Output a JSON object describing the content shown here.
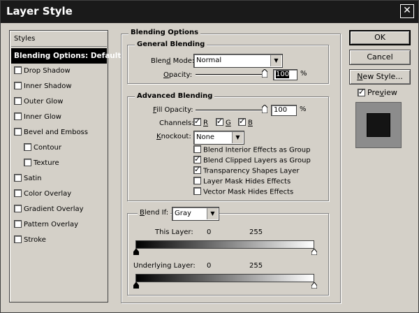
{
  "window": {
    "title": "Layer Style"
  },
  "styles_list": {
    "header": "Styles",
    "selected": "Blending Options: Default",
    "items": [
      {
        "label": "Drop Shadow",
        "checked": false,
        "indent": false
      },
      {
        "label": "Inner Shadow",
        "checked": false,
        "indent": false
      },
      {
        "label": "Outer Glow",
        "checked": false,
        "indent": false
      },
      {
        "label": "Inner Glow",
        "checked": false,
        "indent": false
      },
      {
        "label": "Bevel and Emboss",
        "checked": false,
        "indent": false
      },
      {
        "label": "Contour",
        "checked": false,
        "indent": true
      },
      {
        "label": "Texture",
        "checked": false,
        "indent": true
      },
      {
        "label": "Satin",
        "checked": false,
        "indent": false
      },
      {
        "label": "Color Overlay",
        "checked": false,
        "indent": false
      },
      {
        "label": "Gradient Overlay",
        "checked": false,
        "indent": false
      },
      {
        "label": "Pattern Overlay",
        "checked": false,
        "indent": false
      },
      {
        "label": "Stroke",
        "checked": false,
        "indent": false
      }
    ]
  },
  "blending": {
    "title": "Blending Options",
    "general": {
      "title": "General Blending",
      "blend_mode_label": "Blend Mode:",
      "blend_mode_value": "Normal",
      "opacity_label": "Opacity:",
      "opacity_value": "100",
      "percent": "%"
    },
    "advanced": {
      "title": "Advanced Blending",
      "fill_opacity_label": "Fill Opacity:",
      "fill_opacity_value": "100",
      "percent": "%",
      "channels_label": "Channels:",
      "channel_r": "R",
      "channel_g": "G",
      "channel_b": "B",
      "knockout_label": "Knockout:",
      "knockout_value": "None",
      "options": [
        {
          "label": "Blend Interior Effects as Group",
          "checked": false
        },
        {
          "label": "Blend Clipped Layers as Group",
          "checked": true
        },
        {
          "label": "Transparency Shapes Layer",
          "checked": true
        },
        {
          "label": "Layer Mask Hides Effects",
          "checked": false
        },
        {
          "label": "Vector Mask Hides Effects",
          "checked": false
        }
      ]
    },
    "blend_if": {
      "label": "Blend If:",
      "value": "Gray",
      "this_layer_label": "This Layer:",
      "this_layer_low": "0",
      "this_layer_high": "255",
      "underlying_label": "Underlying Layer:",
      "underlying_low": "0",
      "underlying_high": "255"
    }
  },
  "buttons": {
    "ok": "OK",
    "cancel": "Cancel",
    "new_style": "New Style...",
    "preview_label": "Preview"
  }
}
